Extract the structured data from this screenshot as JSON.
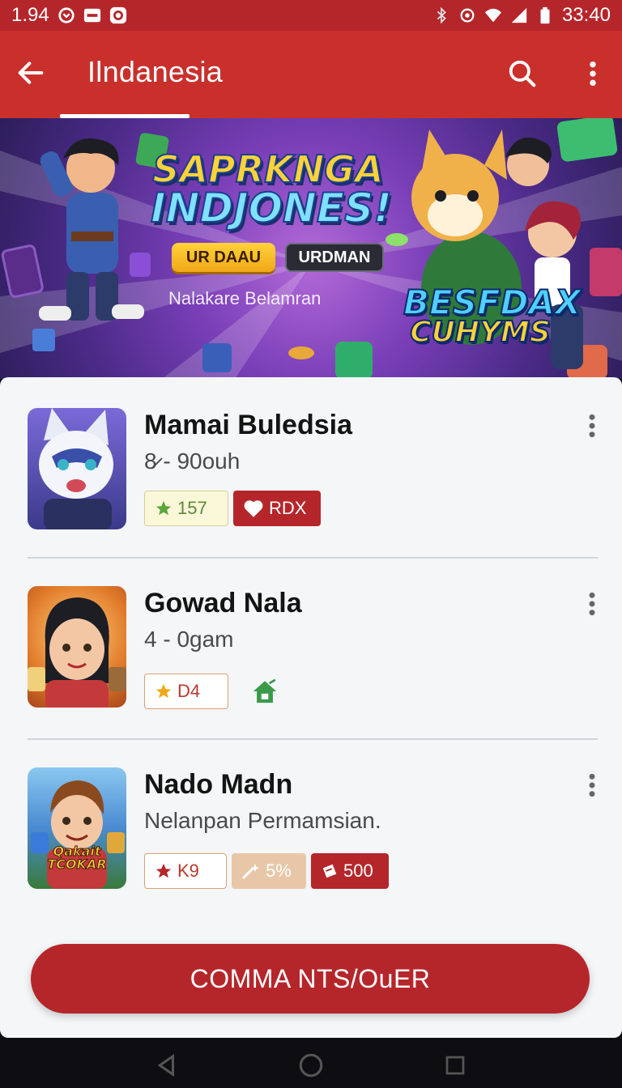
{
  "status_bar": {
    "time_left": "1.94",
    "time_right": "33:40",
    "icons": [
      "sync-icon",
      "notification-icon",
      "circle-icon",
      "bluetooth-icon",
      "location-icon",
      "wifi-icon",
      "signal-icon",
      "battery-icon"
    ]
  },
  "app_bar": {
    "title": "Ilndanesia",
    "icons": [
      "back-arrow-icon",
      "search-icon",
      "more-vert-icon"
    ],
    "color": "#c9302c"
  },
  "banner": {
    "title_line1": "SAPRKNGA",
    "title_line2": "INDJONES!",
    "button_primary": "UR DAAU",
    "button_secondary": "URDMAN",
    "subtitle": "Nalakare Belamran",
    "badge_line1": "BESFDAX",
    "badge_line2": "CUHYMS"
  },
  "items": [
    {
      "title": "Mamai Buledsia",
      "subtitle": "8̷ - 90ouh",
      "thumb_icon": "cat-character-icon",
      "tags": [
        {
          "icon": "star-icon",
          "label": "157",
          "style": "light"
        },
        {
          "icon": "heart-icon",
          "label": "RDX",
          "style": "red"
        }
      ]
    },
    {
      "title": "Gowad Nala",
      "subtitle": "4 - 0gam",
      "thumb_icon": "girl-character-icon",
      "tags": [
        {
          "icon": "star-icon",
          "label": "D4",
          "style": "outline"
        },
        {
          "icon": "house-icon",
          "label": "",
          "style": "icon-only"
        }
      ]
    },
    {
      "title": "Nado Madn",
      "subtitle": "Nelanpan Permamsian.",
      "thumb_icon": "boy-character-icon",
      "thumb_text": "Qakait TCOKAR",
      "tags": [
        {
          "icon": "star-icon",
          "label": "K9",
          "style": "outline"
        },
        {
          "icon": "wand-icon",
          "label": "5%",
          "style": "beige"
        },
        {
          "icon": "ticket-icon",
          "label": "500",
          "style": "red"
        }
      ]
    }
  ],
  "cta": {
    "label": "COMMA NTS/OuER"
  },
  "nav_bar": {
    "icons": [
      "back-triangle-icon",
      "home-circle-icon",
      "recents-square-icon"
    ]
  }
}
